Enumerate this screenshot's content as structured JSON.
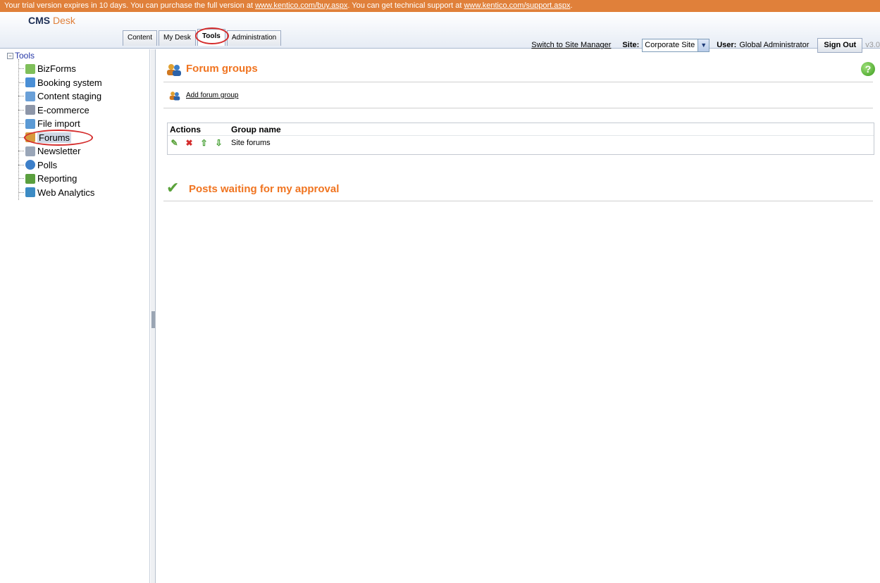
{
  "trial_bar": {
    "prefix": "Your trial version expires in 10 days. You can purchase the full version at ",
    "buy_link": "www.kentico.com/buy.aspx",
    "middle": ". You can get technical support at ",
    "support_link": "www.kentico.com/support.aspx",
    "suffix": "."
  },
  "header": {
    "logo_cms": "CMS",
    "logo_desk": "Desk",
    "tabs": [
      {
        "label": "Content"
      },
      {
        "label": "My Desk"
      },
      {
        "label": "Tools"
      },
      {
        "label": "Administration"
      }
    ],
    "switch_link": "Switch to Site Manager",
    "site_label": "Site:",
    "site_value": "Corporate Site",
    "user_label": "User:",
    "user_value": "Global Administrator",
    "signout": "Sign Out",
    "version": "v3.0"
  },
  "tree": {
    "root_toggle": "−",
    "root": "Tools",
    "items": [
      {
        "label": "BizForms",
        "icon": "bizforms-icon",
        "color": "#7fbf5a"
      },
      {
        "label": "Booking system",
        "icon": "booking-icon",
        "color": "#4a8fd6"
      },
      {
        "label": "Content staging",
        "icon": "staging-icon",
        "color": "#6aa0d8"
      },
      {
        "label": "E-commerce",
        "icon": "ecommerce-icon",
        "color": "#8d96a8"
      },
      {
        "label": "File import",
        "icon": "file-import-icon",
        "color": "#5b9ad5"
      },
      {
        "label": "Forums",
        "icon": "forums-icon",
        "color": "#d79a3c"
      },
      {
        "label": "Newsletter",
        "icon": "newsletter-icon",
        "color": "#9aa6b8"
      },
      {
        "label": "Polls",
        "icon": "polls-icon",
        "color": "#3d7fc9"
      },
      {
        "label": "Reporting",
        "icon": "reporting-icon",
        "color": "#5a9f3e"
      },
      {
        "label": "Web Analytics",
        "icon": "web-analytics-icon",
        "color": "#3c8bc4"
      }
    ]
  },
  "main": {
    "title": "Forum groups",
    "add_link": "Add forum group",
    "help": "?",
    "grid": {
      "headers": [
        "Actions",
        "Group name"
      ],
      "rows": [
        {
          "group_name": "Site forums"
        }
      ]
    },
    "section2_title": "Posts waiting for my approval"
  },
  "colors": {
    "accent": "#f07420",
    "trial_bar": "#e0803a",
    "highlight_ring": "#d42c2c"
  }
}
